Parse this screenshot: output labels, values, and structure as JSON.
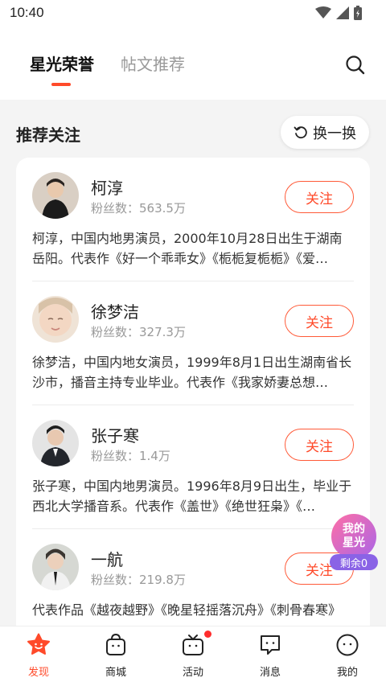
{
  "status_bar": {
    "time": "10:40"
  },
  "header": {
    "tabs": [
      {
        "label": "星光荣誉",
        "active": true
      },
      {
        "label": "帖文推荐",
        "active": false
      }
    ]
  },
  "section": {
    "title": "推荐关注",
    "refresh_label": "换一换"
  },
  "recommendations": [
    {
      "name": "柯淳",
      "fans": "粉丝数：563.5万",
      "follow_label": "关注",
      "desc": "柯淳，中国内地男演员，2000年10月28日出生于湖南岳阳。代表作《好一个乖乖女》《栀栀复栀栀》《爱…"
    },
    {
      "name": "徐梦洁",
      "fans": "粉丝数：327.3万",
      "follow_label": "关注",
      "desc": "徐梦洁，中国内地女演员，1999年8月1日出生湖南省长沙市，播音主持专业毕业。代表作《我家娇妻总想…"
    },
    {
      "name": "张子寒",
      "fans": "粉丝数：1.4万",
      "follow_label": "关注",
      "desc": "张子寒，中国内地男演员。1996年8月9日出生，毕业于西北大学播音系。代表作《盖世》《绝世狂枭》《…"
    },
    {
      "name": "一航",
      "fans": "粉丝数：219.8万",
      "follow_label": "关注",
      "desc": "代表作品《越夜越野》《晚星轻摇落沉舟》《刺骨春寒》"
    }
  ],
  "floating": {
    "title": "我的星光",
    "remain": "剩余0"
  },
  "tabbar": [
    {
      "label": "发现",
      "icon": "discover-icon",
      "active": true
    },
    {
      "label": "商城",
      "icon": "shop-bag-icon",
      "active": false
    },
    {
      "label": "活动",
      "icon": "activity-tv-icon",
      "active": false,
      "badge": true
    },
    {
      "label": "消息",
      "icon": "message-icon",
      "active": false
    },
    {
      "label": "我的",
      "icon": "profile-face-icon",
      "active": false
    }
  ],
  "colors": {
    "accent": "#ff4a2a",
    "star_gradient_start": "#ff6fa5",
    "star_gradient_end": "#a965e8"
  }
}
